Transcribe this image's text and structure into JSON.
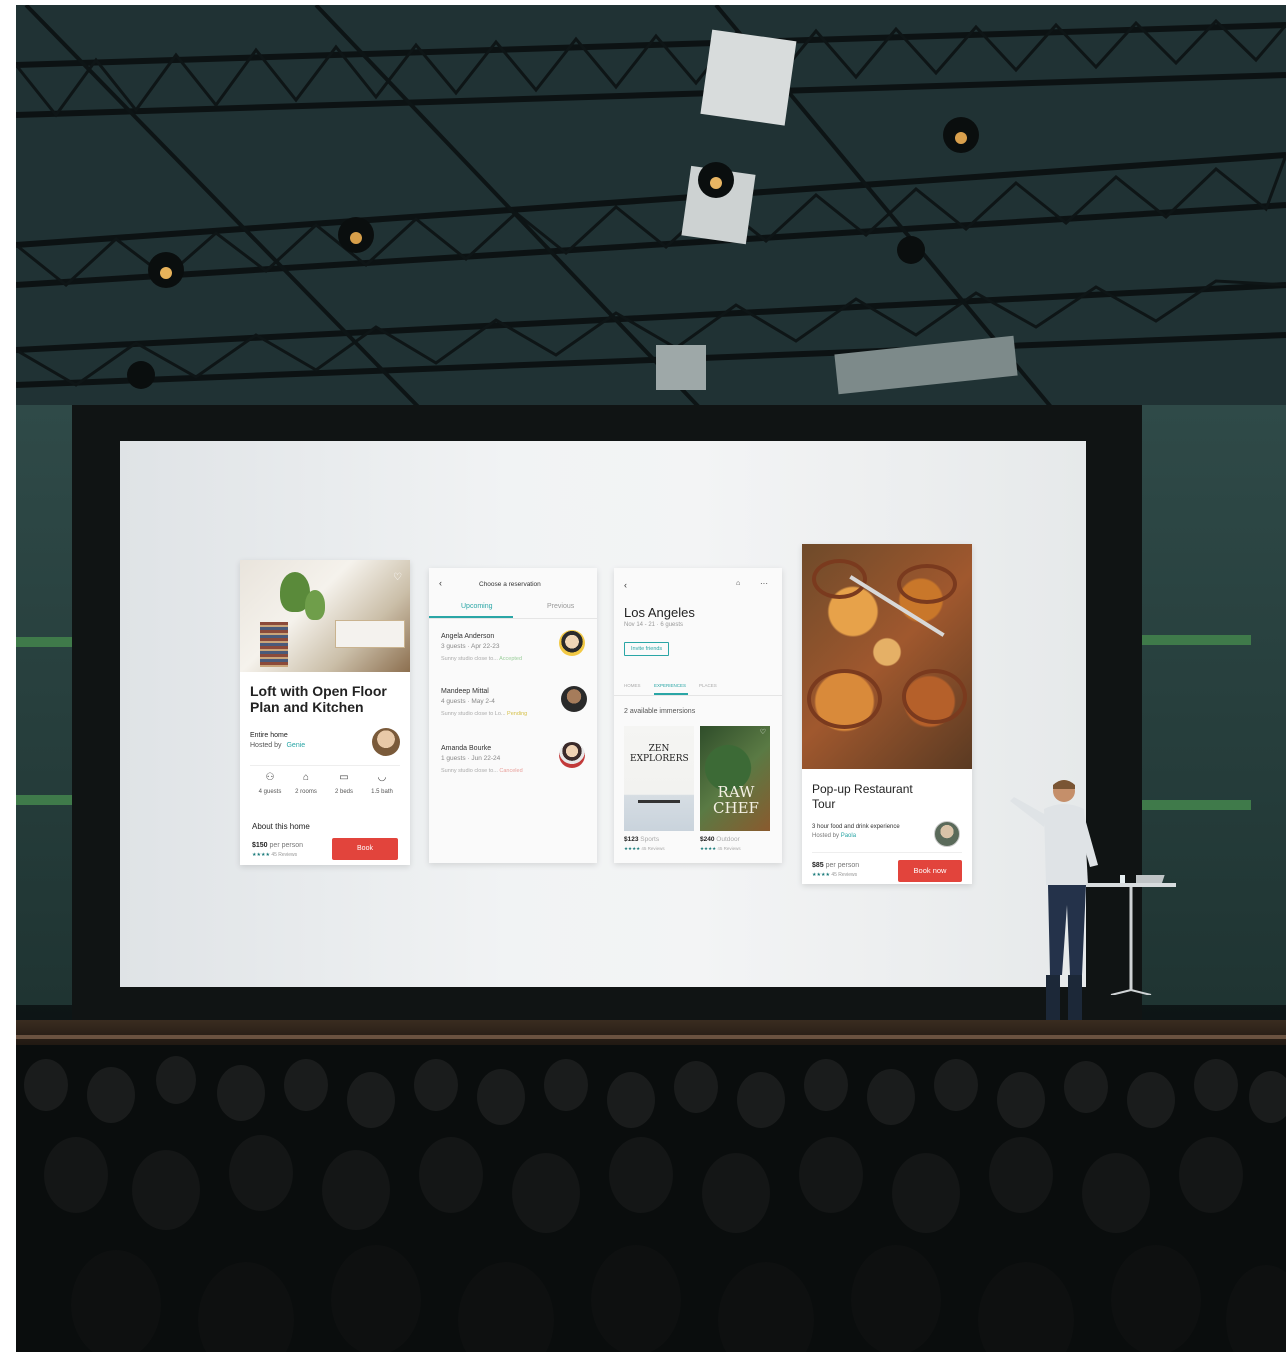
{
  "card1": {
    "title": "Loft with Open Floor Plan and Kitchen",
    "home_type": "Entire home",
    "hosted_by_prefix": "Hosted by",
    "host_name": "Genie",
    "amenities": [
      "4 guests",
      "2 rooms",
      "2 beds",
      "1.5 bath"
    ],
    "about": "About this home",
    "price": "$150",
    "price_unit": "per person",
    "reviews": "45 Reviews",
    "book_label": "Book"
  },
  "card2": {
    "header": "Choose a reservation",
    "tabs": [
      "Upcoming",
      "Previous"
    ],
    "reservations": [
      {
        "name": "Angela Anderson",
        "meta": "3 guests · Apr 22-23",
        "note": "Sunny studio close to...",
        "status": "Accepted",
        "status_color": "#9ccf9c"
      },
      {
        "name": "Mandeep Mittal",
        "meta": "4 guests · May 2-4",
        "note": "Sunny studio close to Lo...",
        "status": "Pending",
        "status_color": "#e6d56a"
      },
      {
        "name": "Amanda Bourke",
        "meta": "1 guests · Jun 22-24",
        "note": "Sunny studio close to...",
        "status": "Canceled",
        "status_color": "#e9a19c"
      }
    ]
  },
  "card3": {
    "city": "Los Angeles",
    "dates": "Nov 14 - 21 · 6 guests",
    "invite_label": "Invite friends",
    "tabs": [
      "HOMES",
      "EXPERIENCES",
      "PLACES"
    ],
    "immersions": "2 available immersions",
    "items": [
      {
        "poster_title": "ZEN EXPLORERS",
        "price": "$123",
        "category": "Sports",
        "reviews": "45 Reviews"
      },
      {
        "poster_title": "RAW CHEF",
        "price": "$240",
        "category": "Outdoor",
        "reviews": "45 Reviews"
      }
    ]
  },
  "card4": {
    "title": "Pop-up Restaurant Tour",
    "description": "3 hour food and drink experience",
    "hosted_by_prefix": "Hosted by",
    "host_name": "Paola",
    "price": "$85",
    "price_unit": "per person",
    "reviews": "45 Reviews",
    "book_label": "Book now"
  },
  "colors": {
    "accent_teal": "#2aa6a6",
    "button_red": "#e2443c",
    "star_teal": "#1c7b7b"
  }
}
